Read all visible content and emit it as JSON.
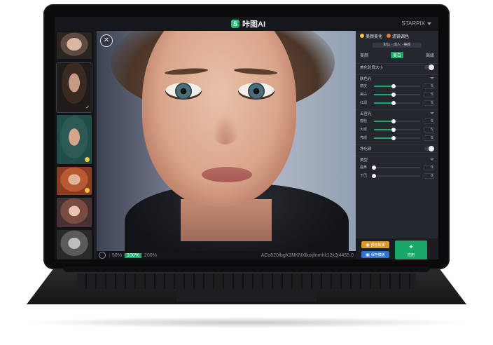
{
  "window": {
    "app_title": "咔图AI",
    "account": "STARPIX",
    "logo_char": "S"
  },
  "tabs": [
    {
      "label": "美颜美化"
    },
    {
      "label": "滤镜调色"
    }
  ],
  "preset": {
    "label": "默认 · 成人 · 美颜"
  },
  "mode": {
    "left": "美颜",
    "active": "美白",
    "right": "高级"
  },
  "sections": {
    "face_adjust": {
      "label": "美化轮廓大小"
    },
    "skin": {
      "label": "肤色光"
    },
    "five": {
      "label": "五官光"
    },
    "body": {
      "label": "净化颜"
    },
    "extra": {
      "label": "美型"
    }
  },
  "sliders": [
    {
      "label": "磨皮",
      "value": "5",
      "level": 0.42
    },
    {
      "label": "美白",
      "value": "5",
      "level": 0.42
    },
    {
      "label": "红润",
      "value": "5",
      "level": 0.42
    },
    {
      "label": "瘦脸",
      "value": "5",
      "level": 0.42
    },
    {
      "label": "大眼",
      "value": "5",
      "level": 0.42
    },
    {
      "label": "亮眼",
      "value": "5",
      "level": 0.42
    },
    {
      "label": "瘦鼻",
      "value": "0",
      "level": 0.0
    },
    {
      "label": "下巴",
      "value": "0",
      "level": 0.0
    }
  ],
  "actions": {
    "preview": "预览效果",
    "save": "保存模板",
    "apply": "应用"
  },
  "statusbar": {
    "zooms": [
      "50%",
      "100%",
      "200%"
    ],
    "active_zoom": "100%",
    "filename": "ACo820fbgK3NKNXlkoijfnmhk12k3j4455.0"
  },
  "colors": {
    "accent": "#1aa86a",
    "warning": "#d99a2b",
    "primary": "#2f74d0",
    "bg": "#1b1d22"
  }
}
